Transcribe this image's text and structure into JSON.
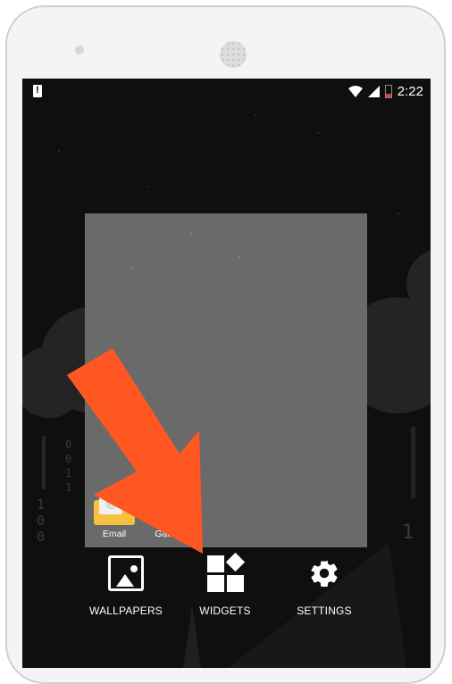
{
  "status_bar": {
    "time": "2:22",
    "icons": [
      "alert-icon",
      "wifi-icon",
      "signal-icon",
      "battery-low-icon"
    ]
  },
  "home_preview": {
    "apps": [
      {
        "label": "Email",
        "icon": "email-icon"
      },
      {
        "label": "Gallery",
        "icon": "gallery-icon"
      }
    ]
  },
  "wallpaper": {
    "binary_left": "1\n0\n0",
    "binary_left2": "0\n0\n1\n1",
    "binary_right": "1"
  },
  "options": {
    "wallpapers_label": "WALLPAPERS",
    "widgets_label": "WIDGETS",
    "settings_label": "SETTINGS"
  },
  "colors": {
    "arrow": "#ff5722",
    "screen_bg": "#0f0f0f",
    "preview_bg": "#6a6a6a",
    "battery_low": "#e53935"
  }
}
